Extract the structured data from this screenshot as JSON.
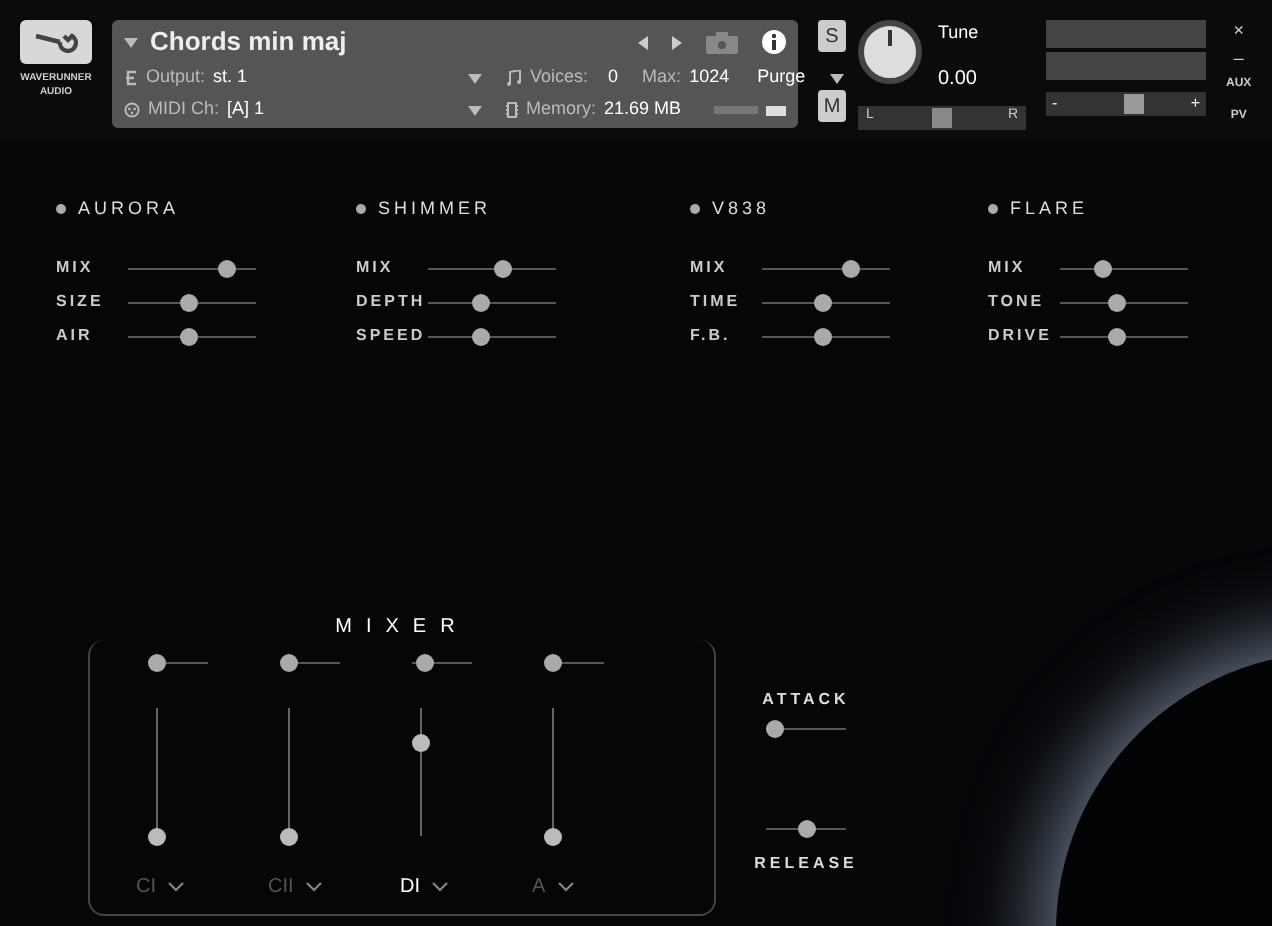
{
  "logo": {
    "text": "WAVERUNNER AUDIO"
  },
  "instrument": {
    "title": "Chords min maj",
    "output_label": "Output:",
    "output_value": "st. 1",
    "midi_label": "MIDI Ch:",
    "midi_value": "[A]  1",
    "voices_label": "Voices:",
    "voices_value": "0",
    "max_label": "Max:",
    "max_value": "1024",
    "memory_label": "Memory:",
    "memory_value": "21.69 MB",
    "purge": "Purge"
  },
  "solo": {
    "label": "S"
  },
  "mute": {
    "label": "M"
  },
  "tune": {
    "label": "Tune",
    "value": "0.00"
  },
  "pan": {
    "left": "L",
    "right": "R",
    "level": 0.5
  },
  "volume": {
    "minus": "-",
    "plus": "+",
    "level": 0.55
  },
  "side": {
    "close": "×",
    "minimize": "–",
    "aux": "AUX",
    "pv": "PV"
  },
  "effects": [
    {
      "name": "AURORA",
      "params": [
        {
          "label": "MIX",
          "level": 0.81
        },
        {
          "label": "SIZE",
          "level": 0.48
        },
        {
          "label": "AIR",
          "level": 0.48
        }
      ]
    },
    {
      "name": "SHIMMER",
      "params": [
        {
          "label": "MIX",
          "level": 0.6
        },
        {
          "label": "DEPTH",
          "level": 0.4
        },
        {
          "label": "SPEED",
          "level": 0.4
        }
      ]
    },
    {
      "name": "V838",
      "params": [
        {
          "label": "MIX",
          "level": 0.73
        },
        {
          "label": "TIME",
          "level": 0.48
        },
        {
          "label": "F.B.",
          "level": 0.48
        }
      ]
    },
    {
      "name": "FLARE",
      "params": [
        {
          "label": "MIX",
          "level": 0.31
        },
        {
          "label": "TONE",
          "level": 0.44
        },
        {
          "label": "DRIVE",
          "level": 0.44
        }
      ]
    }
  ],
  "mixer": {
    "title": "MIXER",
    "channels": [
      {
        "label": "CI",
        "selected": false,
        "pan": {
          "level": 0.0
        },
        "fader": {
          "level": 0.0
        }
      },
      {
        "label": "CII",
        "selected": false,
        "pan": {
          "level": 0.0
        },
        "fader": {
          "level": 0.0
        }
      },
      {
        "label": "DI",
        "selected": true,
        "pan": {
          "level": 0.1
        },
        "fader": {
          "level": 0.78
        }
      },
      {
        "label": "A",
        "selected": false,
        "pan": {
          "level": 0.0
        },
        "fader": {
          "level": 0.0
        }
      }
    ]
  },
  "envelope": [
    {
      "label": "ATTACK",
      "level": 0.0
    },
    {
      "label": "RELEASE",
      "level": 0.5
    }
  ]
}
